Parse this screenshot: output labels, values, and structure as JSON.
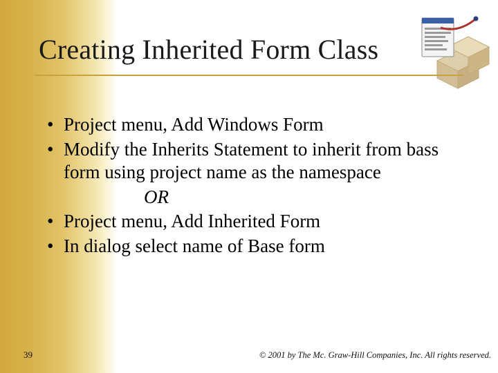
{
  "slide": {
    "title": "Creating Inherited Form Class",
    "bullets": [
      "Project menu, Add Windows Form",
      "Modify the Inherits Statement to inherit from bass form using project name as the namespace",
      "Project menu, Add Inherited Form",
      "In dialog select name of Base form"
    ],
    "or_text": "OR",
    "page_number": "39",
    "copyright": "© 2001 by The Mc. Graw-Hill Companies, Inc. All rights reserved."
  },
  "colors": {
    "gold": "#d2a93c",
    "underline": "#caa23d"
  }
}
